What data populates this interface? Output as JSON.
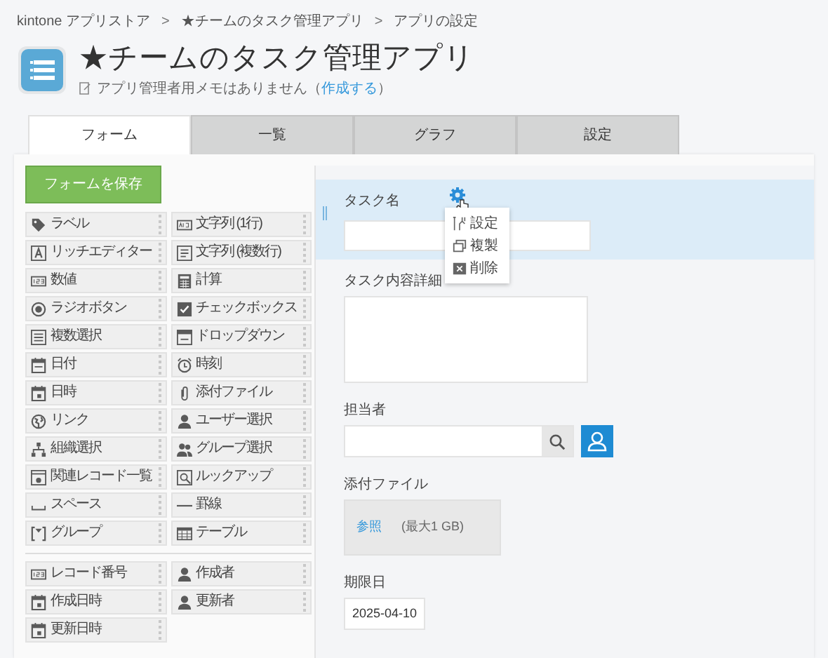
{
  "breadcrumb": [
    {
      "kind": "link",
      "text": "kintone アプリストア"
    },
    {
      "kind": "separator",
      "text": ">"
    },
    {
      "kind": "link",
      "text": "★チームのタスク管理アプリ"
    },
    {
      "kind": "separator",
      "text": ">"
    },
    {
      "kind": "current",
      "text": "アプリの設定"
    }
  ],
  "app": {
    "title": "★チームのタスク管理アプリ",
    "memo_before": "アプリ管理者用メモはありません（",
    "memo_link": "作成する",
    "memo_after": "）"
  },
  "tabs": [
    {
      "label": "フォーム",
      "selected": true
    },
    {
      "label": "一覧",
      "selected": false
    },
    {
      "label": "グラフ",
      "selected": false
    },
    {
      "label": "設定",
      "selected": false
    }
  ],
  "save_button": "フォームを保存",
  "palette": [
    {
      "label": "ラベル"
    },
    {
      "label": "文字列 (1行)"
    },
    {
      "label": "リッチエディター"
    },
    {
      "label": "文字列 (複数行)"
    },
    {
      "label": "数値"
    },
    {
      "label": "計算"
    },
    {
      "label": "ラジオボタン"
    },
    {
      "label": "チェックボックス"
    },
    {
      "label": "複数選択"
    },
    {
      "label": "ドロップダウン"
    },
    {
      "label": "日付"
    },
    {
      "label": "時刻"
    },
    {
      "label": "日時"
    },
    {
      "label": "添付ファイル"
    },
    {
      "label": "リンク"
    },
    {
      "label": "ユーザー選択"
    },
    {
      "label": "組織選択"
    },
    {
      "label": "グループ選択"
    },
    {
      "label": "関連レコード一覧"
    },
    {
      "label": "ルックアップ"
    },
    {
      "label": "スペース"
    },
    {
      "label": "罫線"
    },
    {
      "label": "グループ"
    },
    {
      "label": "テーブル"
    }
  ],
  "system_fields": [
    {
      "label": "レコード番号"
    },
    {
      "label": "作成者"
    },
    {
      "label": "作成日時"
    },
    {
      "label": "更新者"
    },
    {
      "label": "更新日時"
    }
  ],
  "form_fields": [
    {
      "kind": "text",
      "label": "タスク名",
      "selected": true
    },
    {
      "kind": "textarea",
      "label": "タスク内容詳細",
      "selected": false
    },
    {
      "kind": "user",
      "label": "担当者",
      "selected": false
    },
    {
      "kind": "file",
      "label": "添付ファイル",
      "selected": false,
      "browse": "参照",
      "limit": "(最大1 GB)"
    },
    {
      "kind": "date",
      "label": "期限日",
      "selected": false,
      "value": "2025-04-10"
    }
  ],
  "context_menu": [
    {
      "label": "設定"
    },
    {
      "label": "複製"
    },
    {
      "label": "削除"
    }
  ]
}
